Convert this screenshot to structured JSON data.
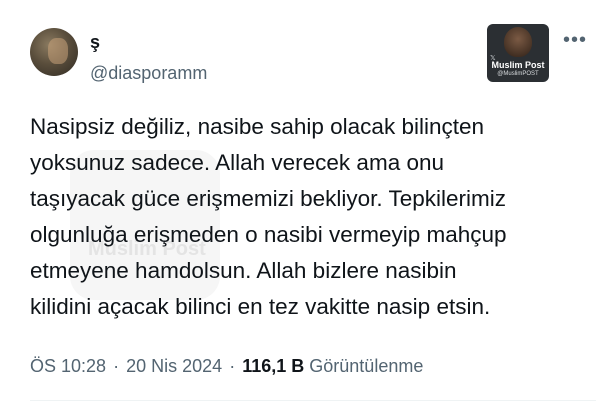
{
  "author": {
    "display_name": "ş",
    "handle": "@diasporamm"
  },
  "badge": {
    "title": "Muslim Post",
    "subtitle": "@MuslimPOST",
    "icon": "x-logo-icon"
  },
  "watermark": {
    "text": "Muslim Post"
  },
  "menu": {
    "more_label": "•••"
  },
  "tweet": {
    "lines": [
      "Nasipsiz değiliz, nasibe sahip olacak bilinçten",
      "yoksunuz sadece. Allah verecek ama onu",
      "taşıyacak güce erişmemizi bekliyor. Tepkilerimiz",
      "olgunluğa erişmeden o nasibi vermeyip mahçup",
      "etmeyene hamdolsun. Allah bizlere nasibin",
      "kilidini açacak bilinci en tez vakitte nasip etsin."
    ]
  },
  "meta": {
    "time": "ÖS 10:28",
    "date": "20 Nis 2024",
    "views_count": "116,1 B",
    "views_label": "Görüntülenme",
    "separator": "·"
  },
  "colors": {
    "text": "#0f1419",
    "secondary": "#536471",
    "background": "#ffffff"
  }
}
